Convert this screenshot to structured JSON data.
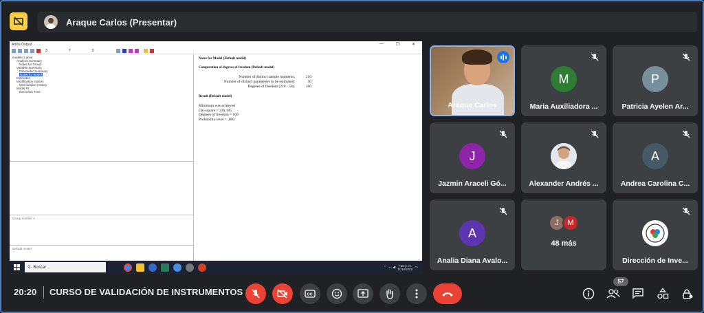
{
  "presenter": {
    "name": "Araque Carlos (Presentar)"
  },
  "shared_screen": {
    "window_title": "Amos Output",
    "toolbar_values": [
      "3",
      "7",
      "0"
    ],
    "tree": [
      "Analysis Summary",
      "Notes for Group",
      "Variable Summary",
      "Parameter Summary",
      "Notes for Model",
      "Estimates",
      "Modification Indices",
      "Minimization History",
      "Model Fit",
      "Execution Time"
    ],
    "tree_root": "modelo 1.amw",
    "selected_item": "Notes for Model",
    "group_pane": "Group number 1",
    "model_pane": "Default model",
    "notes_title": "Notes for Model (Default model)",
    "df_title": "Computation of degrees of freedom (Default model)",
    "df_rows": [
      {
        "label": "Number of distinct sample moments:",
        "value": "210"
      },
      {
        "label": "Number of distinct parameters to be estimated:",
        "value": "50"
      },
      {
        "label": "Degrees of freedom (210 - 50):",
        "value": "160"
      }
    ],
    "result_title": "Result (Default model)",
    "result_lines": [
      "Minimum was achieved",
      "Chi-square = 230,185",
      "Degrees of freedom = 160",
      "Probability level = ,000"
    ],
    "taskbar_search": "Buscar",
    "clock_time": "7:20 p. m.",
    "clock_date": "11/10/2023"
  },
  "tiles": [
    {
      "name": "Araque Carlos",
      "type": "camera"
    },
    {
      "name": "Maria Auxiliadora ...",
      "initial": "M",
      "color": "#2e7d32"
    },
    {
      "name": "Patricia Ayelen Ar...",
      "initial": "P",
      "color": "#78909c"
    },
    {
      "name": "Jazmin Araceli Gó...",
      "initial": "J",
      "color": "#8e24aa"
    },
    {
      "name": "Alexander Andrés ...",
      "type": "photo"
    },
    {
      "name": "Andrea Carolina C...",
      "initial": "A",
      "color": "#455a64"
    },
    {
      "name": "Analia Diana Avalo...",
      "initial": "A",
      "color": "#5e35b1"
    },
    {
      "name": "48 más",
      "avatars": [
        "J",
        "M"
      ],
      "avatar_colors": [
        "#8d6e63",
        "#c62828"
      ]
    },
    {
      "name": "Dirección de Inve...",
      "type": "logo"
    }
  ],
  "bottom_bar": {
    "time": "20:20",
    "meeting_title": "CURSO DE VALIDACIÓN DE INSTRUMENTOS 1...",
    "participant_count": "57"
  },
  "colors": {
    "accent": "#1a73e8",
    "danger": "#ea4335",
    "tile": "#3c4043",
    "background": "#202124"
  }
}
